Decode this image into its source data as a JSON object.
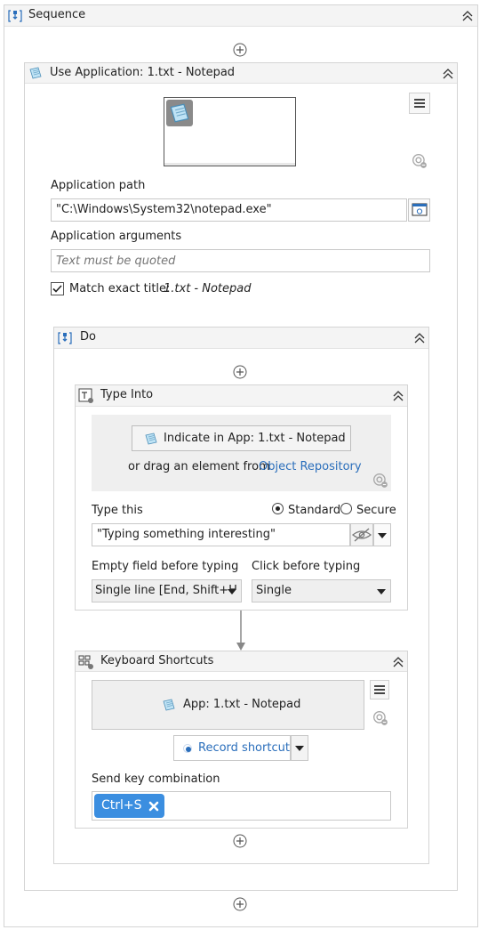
{
  "sequence": {
    "title": "Sequence"
  },
  "use_app": {
    "title": "Use Application: 1.txt - Notepad",
    "app_path_label": "Application path",
    "app_path_value": "\"C:\\Windows\\System32\\notepad.exe\"",
    "app_args_label": "Application arguments",
    "app_args_placeholder": "Text must be quoted",
    "match_title_label": "Match exact title:",
    "match_title_value": "1.txt - Notepad",
    "match_title_checked": true
  },
  "do": {
    "title": "Do"
  },
  "type_into": {
    "title": "Type Into",
    "indicate_label": "Indicate in App: 1.txt - Notepad",
    "drag_text": "or drag an element from",
    "object_repo_link": "Object Repository",
    "type_this_label": "Type this",
    "standard_label": "Standard",
    "secure_label": "Secure",
    "selected_mode": "Standard",
    "type_value": "\"Typing something interesting\"",
    "empty_field_label": "Empty field before typing",
    "empty_field_value": "Single line [End, Shift+H",
    "click_before_label": "Click before typing",
    "click_before_value": "Single"
  },
  "keyboard_shortcuts": {
    "title": "Keyboard Shortcuts",
    "app_target": "App: 1.txt - Notepad",
    "record_label": "Record shortcut",
    "send_key_label": "Send key combination",
    "shortcut_chip": "Ctrl+S"
  },
  "colors": {
    "accent": "#2a6ebb",
    "chip": "#3b8ee0",
    "header_bg": "#f4f4f4",
    "border": "#d4d4d4"
  }
}
